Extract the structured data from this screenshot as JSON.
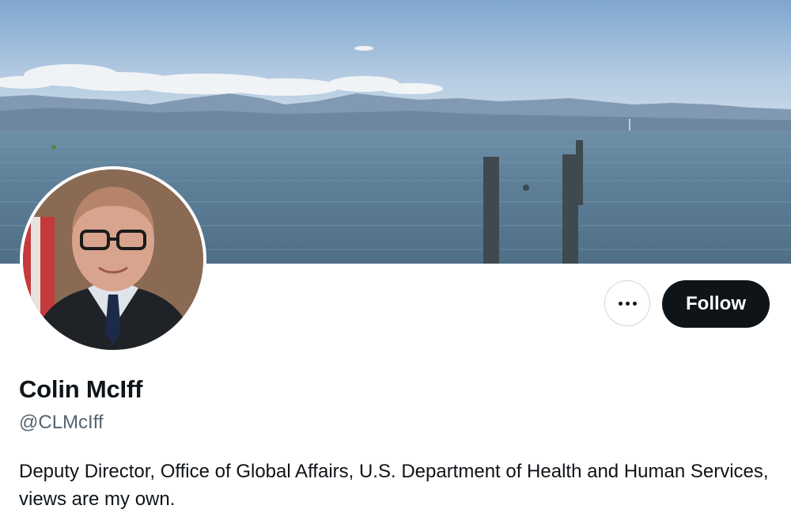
{
  "profile": {
    "display_name": "Colin McIff",
    "handle": "@CLMcIff",
    "bio": "Deputy Director, Office of Global Affairs, U.S. Department of Health and Human Services, views are my own."
  },
  "actions": {
    "follow_label": "Follow",
    "more_icon": "more-horizontal-icon"
  },
  "colors": {
    "follow_bg": "#0f1419",
    "text_primary": "#0f1419",
    "text_secondary": "#536471",
    "border": "#cfd9de"
  }
}
